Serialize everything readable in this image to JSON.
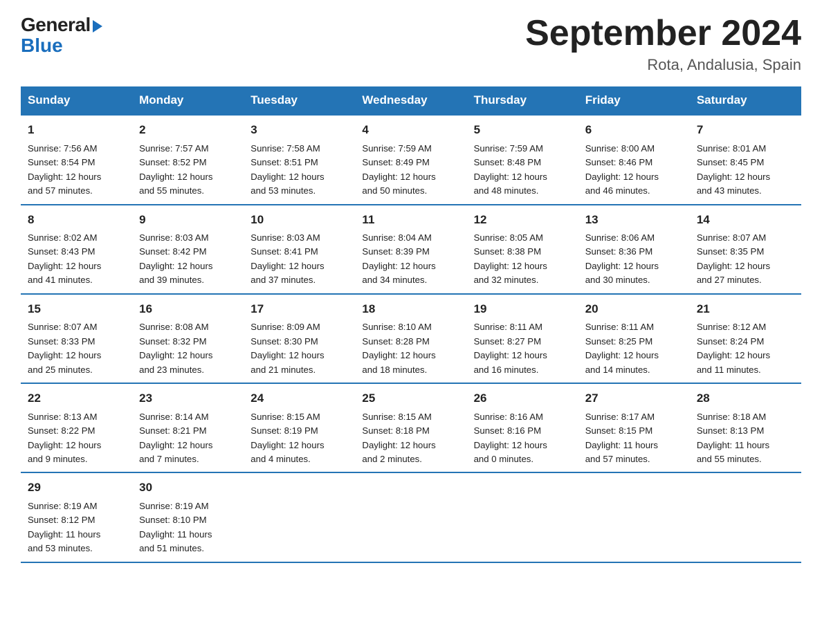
{
  "header": {
    "logo_general": "General",
    "logo_blue": "Blue",
    "title": "September 2024",
    "location": "Rota, Andalusia, Spain"
  },
  "days_of_week": [
    "Sunday",
    "Monday",
    "Tuesday",
    "Wednesday",
    "Thursday",
    "Friday",
    "Saturday"
  ],
  "weeks": [
    [
      {
        "day": "1",
        "sunrise": "7:56 AM",
        "sunset": "8:54 PM",
        "daylight": "12 hours and 57 minutes."
      },
      {
        "day": "2",
        "sunrise": "7:57 AM",
        "sunset": "8:52 PM",
        "daylight": "12 hours and 55 minutes."
      },
      {
        "day": "3",
        "sunrise": "7:58 AM",
        "sunset": "8:51 PM",
        "daylight": "12 hours and 53 minutes."
      },
      {
        "day": "4",
        "sunrise": "7:59 AM",
        "sunset": "8:49 PM",
        "daylight": "12 hours and 50 minutes."
      },
      {
        "day": "5",
        "sunrise": "7:59 AM",
        "sunset": "8:48 PM",
        "daylight": "12 hours and 48 minutes."
      },
      {
        "day": "6",
        "sunrise": "8:00 AM",
        "sunset": "8:46 PM",
        "daylight": "12 hours and 46 minutes."
      },
      {
        "day": "7",
        "sunrise": "8:01 AM",
        "sunset": "8:45 PM",
        "daylight": "12 hours and 43 minutes."
      }
    ],
    [
      {
        "day": "8",
        "sunrise": "8:02 AM",
        "sunset": "8:43 PM",
        "daylight": "12 hours and 41 minutes."
      },
      {
        "day": "9",
        "sunrise": "8:03 AM",
        "sunset": "8:42 PM",
        "daylight": "12 hours and 39 minutes."
      },
      {
        "day": "10",
        "sunrise": "8:03 AM",
        "sunset": "8:41 PM",
        "daylight": "12 hours and 37 minutes."
      },
      {
        "day": "11",
        "sunrise": "8:04 AM",
        "sunset": "8:39 PM",
        "daylight": "12 hours and 34 minutes."
      },
      {
        "day": "12",
        "sunrise": "8:05 AM",
        "sunset": "8:38 PM",
        "daylight": "12 hours and 32 minutes."
      },
      {
        "day": "13",
        "sunrise": "8:06 AM",
        "sunset": "8:36 PM",
        "daylight": "12 hours and 30 minutes."
      },
      {
        "day": "14",
        "sunrise": "8:07 AM",
        "sunset": "8:35 PM",
        "daylight": "12 hours and 27 minutes."
      }
    ],
    [
      {
        "day": "15",
        "sunrise": "8:07 AM",
        "sunset": "8:33 PM",
        "daylight": "12 hours and 25 minutes."
      },
      {
        "day": "16",
        "sunrise": "8:08 AM",
        "sunset": "8:32 PM",
        "daylight": "12 hours and 23 minutes."
      },
      {
        "day": "17",
        "sunrise": "8:09 AM",
        "sunset": "8:30 PM",
        "daylight": "12 hours and 21 minutes."
      },
      {
        "day": "18",
        "sunrise": "8:10 AM",
        "sunset": "8:28 PM",
        "daylight": "12 hours and 18 minutes."
      },
      {
        "day": "19",
        "sunrise": "8:11 AM",
        "sunset": "8:27 PM",
        "daylight": "12 hours and 16 minutes."
      },
      {
        "day": "20",
        "sunrise": "8:11 AM",
        "sunset": "8:25 PM",
        "daylight": "12 hours and 14 minutes."
      },
      {
        "day": "21",
        "sunrise": "8:12 AM",
        "sunset": "8:24 PM",
        "daylight": "12 hours and 11 minutes."
      }
    ],
    [
      {
        "day": "22",
        "sunrise": "8:13 AM",
        "sunset": "8:22 PM",
        "daylight": "12 hours and 9 minutes."
      },
      {
        "day": "23",
        "sunrise": "8:14 AM",
        "sunset": "8:21 PM",
        "daylight": "12 hours and 7 minutes."
      },
      {
        "day": "24",
        "sunrise": "8:15 AM",
        "sunset": "8:19 PM",
        "daylight": "12 hours and 4 minutes."
      },
      {
        "day": "25",
        "sunrise": "8:15 AM",
        "sunset": "8:18 PM",
        "daylight": "12 hours and 2 minutes."
      },
      {
        "day": "26",
        "sunrise": "8:16 AM",
        "sunset": "8:16 PM",
        "daylight": "12 hours and 0 minutes."
      },
      {
        "day": "27",
        "sunrise": "8:17 AM",
        "sunset": "8:15 PM",
        "daylight": "11 hours and 57 minutes."
      },
      {
        "day": "28",
        "sunrise": "8:18 AM",
        "sunset": "8:13 PM",
        "daylight": "11 hours and 55 minutes."
      }
    ],
    [
      {
        "day": "29",
        "sunrise": "8:19 AM",
        "sunset": "8:12 PM",
        "daylight": "11 hours and 53 minutes."
      },
      {
        "day": "30",
        "sunrise": "8:19 AM",
        "sunset": "8:10 PM",
        "daylight": "11 hours and 51 minutes."
      },
      null,
      null,
      null,
      null,
      null
    ]
  ]
}
